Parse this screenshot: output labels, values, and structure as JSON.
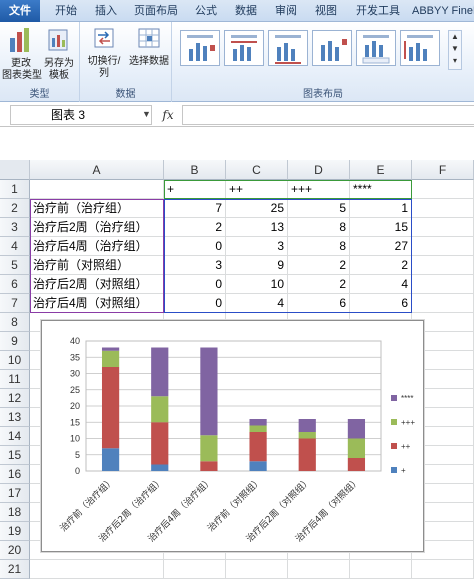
{
  "tabs": [
    "文件",
    "开始",
    "插入",
    "页面布局",
    "公式",
    "数据",
    "审阅",
    "视图",
    "开发工具",
    "ABBYY FineR"
  ],
  "ribbon": {
    "type_group": {
      "label": "类型",
      "change_type": "更改\n图表类型",
      "save_template": "另存为\n模板"
    },
    "data_group": {
      "label": "数据",
      "switch_row_col": "切换行/列",
      "select_data": "选择数据"
    },
    "layout_group": {
      "label": "图表布局"
    }
  },
  "formula_bar": {
    "name_box": "图表 3",
    "fx": "fx"
  },
  "columns": [
    "A",
    "B",
    "C",
    "D",
    "E",
    "F"
  ],
  "rows": [
    "1",
    "2",
    "3",
    "4",
    "5",
    "6",
    "7",
    "8",
    "9",
    "10",
    "11",
    "12",
    "13",
    "14",
    "15",
    "16",
    "17",
    "18",
    "19",
    "20",
    "21"
  ],
  "header_row": [
    "",
    "+",
    "++",
    "+++",
    "****"
  ],
  "table": [
    {
      "label": "治疗前（治疗组）",
      "values": [
        7,
        25,
        5,
        1
      ]
    },
    {
      "label": "治疗后2周（治疗组）",
      "values": [
        2,
        13,
        8,
        15
      ]
    },
    {
      "label": "治疗后4周（治疗组）",
      "values": [
        0,
        3,
        8,
        27
      ]
    },
    {
      "label": "治疗前（对照组）",
      "values": [
        3,
        9,
        2,
        2
      ]
    },
    {
      "label": "治疗后2周（对照组）",
      "values": [
        0,
        10,
        2,
        4
      ]
    },
    {
      "label": "治疗后4周（对照组）",
      "values": [
        0,
        4,
        6,
        6
      ]
    }
  ],
  "chart_data": {
    "type": "bar",
    "stacked": true,
    "categories": [
      "治疗前（治疗组）",
      "治疗后2周（治疗组）",
      "治疗后4周（治疗组）",
      "治疗前（对照组）",
      "治疗后2周（对照组）",
      "治疗后4周（对照组）"
    ],
    "series": [
      {
        "name": "+",
        "color": "#4f81bd",
        "values": [
          7,
          2,
          0,
          3,
          0,
          0
        ]
      },
      {
        "name": "++",
        "color": "#c0504d",
        "values": [
          25,
          13,
          3,
          9,
          10,
          4
        ]
      },
      {
        "name": "+++",
        "color": "#9bbb59",
        "values": [
          5,
          8,
          8,
          2,
          2,
          6
        ]
      },
      {
        "name": "****",
        "color": "#8064a2",
        "values": [
          1,
          15,
          27,
          2,
          4,
          6
        ]
      }
    ],
    "ylim": [
      0,
      40
    ],
    "yticks": [
      0,
      5,
      10,
      15,
      20,
      25,
      30,
      35,
      40
    ],
    "legend": "right",
    "grid": true
  }
}
